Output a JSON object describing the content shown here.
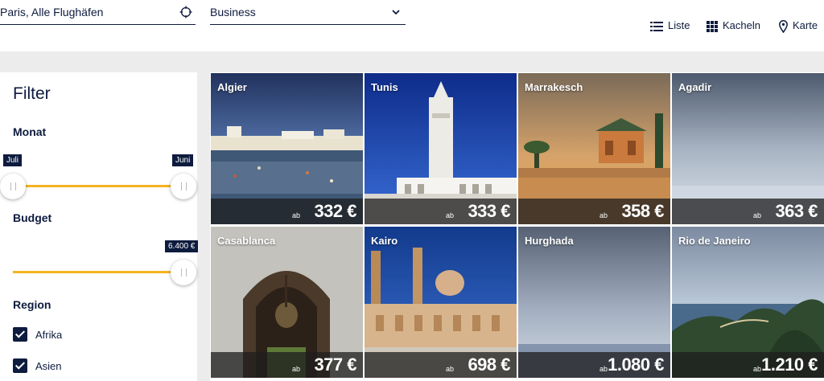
{
  "search": {
    "origin_value": "Paris, Alle Flughäfen",
    "cabin_value": "Business",
    "origin_icon": "crosshair-icon",
    "cabin_icon": "chevron-down-icon"
  },
  "view_switch": {
    "list_label": "Liste",
    "tiles_label": "Kacheln",
    "map_label": "Karte"
  },
  "filter": {
    "title": "Filter",
    "month": {
      "label": "Monat",
      "from": "Juli",
      "to": "Juni"
    },
    "budget": {
      "label": "Budget",
      "max": "6.400 €"
    },
    "region": {
      "label": "Region",
      "items": [
        {
          "label": "Afrika",
          "checked": true
        },
        {
          "label": "Asien",
          "checked": true
        }
      ]
    }
  },
  "destinations": [
    {
      "city": "Algier",
      "ab": "ab",
      "price": "332 €"
    },
    {
      "city": "Tunis",
      "ab": "ab",
      "price": "333 €"
    },
    {
      "city": "Marrakesch",
      "ab": "ab",
      "price": "358 €"
    },
    {
      "city": "Agadir",
      "ab": "ab",
      "price": "363 €"
    },
    {
      "city": "Casablanca",
      "ab": "ab",
      "price": "377 €"
    },
    {
      "city": "Kairo",
      "ab": "ab",
      "price": "698 €"
    },
    {
      "city": "Hurghada",
      "ab": "ab",
      "price": "1.080 €"
    },
    {
      "city": "Rio de Janeiro",
      "ab": "ab",
      "price": "1.210 €"
    }
  ],
  "colors": {
    "navy": "#0d1b3e",
    "accent": "#f4b321",
    "gray": "#ececec"
  }
}
